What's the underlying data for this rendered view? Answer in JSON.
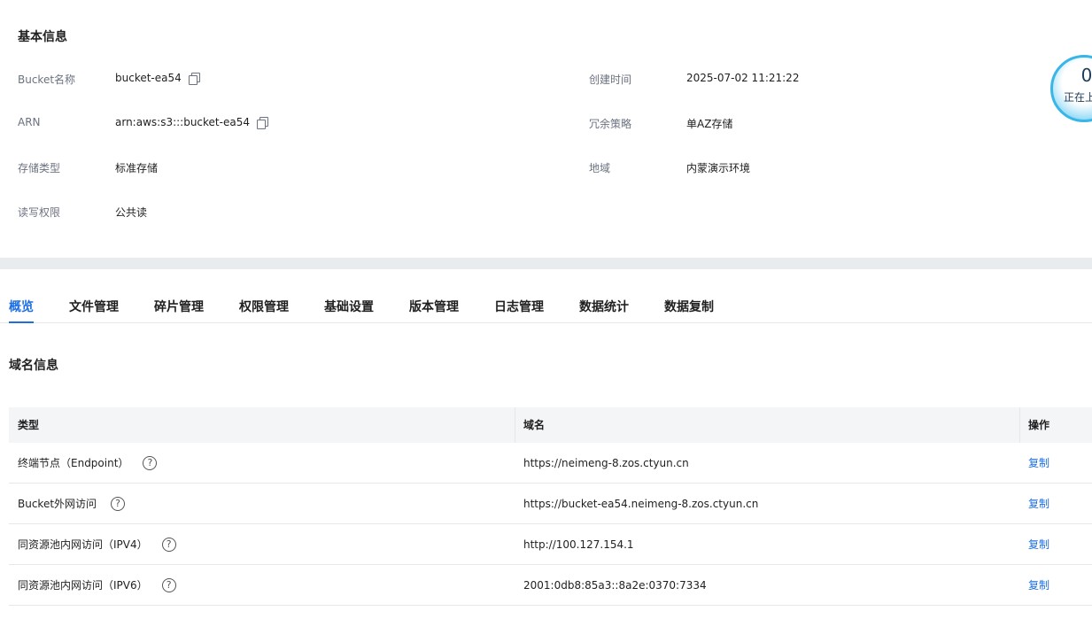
{
  "basic_info": {
    "title": "基本信息",
    "fields": [
      {
        "label": "Bucket名称",
        "value": "bucket-ea54"
      },
      {
        "label": "ARN",
        "value": "arn:aws:s3:::bucket-ea54"
      },
      {
        "label": "存储类型",
        "value": "标准存储"
      },
      {
        "label": "读写权限",
        "value": "公共读"
      },
      {
        "label": "创建时间",
        "value": "2025-07-02 11:21:22"
      },
      {
        "label": "冗余策略",
        "value": "单AZ存储"
      },
      {
        "label": "地域",
        "value": "内蒙演示环境"
      }
    ]
  },
  "upload_widget": {
    "count": "0",
    "label": "正在上"
  },
  "tabs": [
    "概览",
    "文件管理",
    "碎片管理",
    "权限管理",
    "基础设置",
    "版本管理",
    "日志管理",
    "数据统计",
    "数据复制"
  ],
  "domain_section": {
    "title": "域名信息",
    "headers": [
      "类型",
      "域名",
      "操作"
    ],
    "rows": [
      {
        "type": "终端节点（Endpoint）",
        "domain": "https://neimeng-8.zos.ctyun.cn",
        "action": "复制"
      },
      {
        "type": "Bucket外网访问",
        "domain": "https://bucket-ea54.neimeng-8.zos.ctyun.cn",
        "action": "复制"
      },
      {
        "type": "同资源池内网访问（IPV4）",
        "domain": "http://100.127.154.1",
        "action": "复制"
      },
      {
        "type": "同资源池内网访问（IPV6）",
        "domain": "2001:0db8:85a3::8a2e:0370:7334",
        "action": "复制"
      }
    ]
  },
  "colors": {
    "accent": "#1f6fe0",
    "page_band": "#e9ecef",
    "table_header": "#f4f5f7"
  },
  "icons": {
    "copy": "copy-icon",
    "help": "help-icon"
  }
}
